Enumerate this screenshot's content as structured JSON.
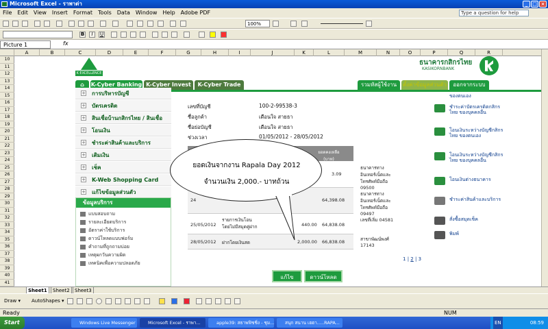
{
  "window": {
    "title": "Microsoft Excel - ราพาด่า"
  },
  "menu": {
    "items": [
      "File",
      "Edit",
      "View",
      "Insert",
      "Format",
      "Tools",
      "Data",
      "Window",
      "Help",
      "Adobe PDF"
    ],
    "help_placeholder": "Type a question for help"
  },
  "toolbar": {
    "zoom": "100%",
    "font_size": ""
  },
  "formula": {
    "namebox": "Picture 1",
    "fx": "fx"
  },
  "columns": [
    "A",
    "B",
    "C",
    "D",
    "E",
    "F",
    "G",
    "H",
    "I",
    "J",
    "K",
    "L",
    "M",
    "N",
    "O",
    "P",
    "Q",
    "R"
  ],
  "rows": [
    "10",
    "11",
    "12",
    "13",
    "14",
    "15",
    "16",
    "17",
    "18",
    "19",
    "20",
    "21",
    "22",
    "23",
    "24",
    "25",
    "26",
    "27",
    "28",
    "29",
    "30",
    "31",
    "32",
    "33",
    "34",
    "35",
    "36",
    "37",
    "38",
    "39",
    "40",
    "41"
  ],
  "bank": {
    "logo_text": "K EXCELLENCE",
    "brand_th": "ธนาคารกสิกรไทย",
    "brand_en": "KASIKORNBANK",
    "tabs": [
      "K-Cyber Banking",
      "K-Cyber Invest",
      "K-Cyber Trade"
    ],
    "right_tabs": [
      "รวมหัสผู้ใช้งาน",
      "ตั้งค่าข้อมูลส่วนตัว",
      "ออกจากระบบ"
    ],
    "left_menu": [
      "การบริหารบัญชี",
      "บัตรเครดิต",
      "สินเชื่อบ้านกสิกรไทย / สินเชื่ออื่นๆ",
      "โอนเงิน",
      "ชำระค่าสินค้าและบริการ",
      "เติมเงิน",
      "เช็ค",
      "K-Web Shopping Card",
      "แก้ไขข้อมูลส่วนตัว"
    ],
    "service_head": "ข้อมูลบริการ",
    "services": [
      "แบบสอบถาม",
      "รายละเอียดบริการ",
      "อัตราค่าใช้บริการ",
      "ดาวน์โหลดแบบฟอร์ม",
      "คำถามที่ถูกถามบ่อย",
      "เหตุผกวันความผิด",
      "เทคนิคเพื่อความปลอดภัย"
    ],
    "info_labels": [
      "เลขที่บัญชี",
      "ชื่อลูกค้า",
      "ชื่อย่อบัญชี",
      "ช่วงเวลา"
    ],
    "info_values": [
      "100-2-99538-3",
      "เดือนใจ สายธา",
      "เดือนใจ สายธา",
      "01/05/2012 - 28/05/2012"
    ],
    "table_headers": [
      "ยอดคงเหลือ (บาท)",
      "ช่องทางบริการ",
      "บันทึก"
    ],
    "rows": [
      {
        "date": "",
        "desc": "",
        "amount": "",
        "balance": "3.09",
        "channel": "ธนาคารทางอินเทอร์เน็ตและโทรศัพท์มือถือ 09500"
      },
      {
        "date": "24",
        "desc": "",
        "amount": "",
        "balance": "64,398.08",
        "channel": "ธนาคารทางอินเทอร์เน็ตและโทรศัพท์มือถือ 09497"
      },
      {
        "date": "25/05/2012",
        "desc": "รายการเงินโอนโดยไม่มีสมุดคู่ฝาก",
        "amount": "440.00",
        "balance": "64,838.08",
        "channel": "เลขที่เลิ่ม 04581"
      },
      {
        "date": "28/05/2012",
        "desc": "ฝากโดยเงินสด",
        "amount": "2,000.00",
        "balance": "66,838.08",
        "channel": "สาขาพัฒน์พงศ์ 17143"
      }
    ],
    "pagination": [
      "1",
      "2",
      "3"
    ],
    "pagination_sep": "|",
    "buttons": [
      "แก้ไข",
      "ดาวน์โหลด"
    ],
    "right_links": [
      "ของตนเอง",
      "ชำระค่าบัตรเครดิตกสิกรไทย ของบุคคลอื่น",
      "โอนเงินระหว่างบัญชีกสิกรไทย ของตนเอง",
      "โอนเงินระหว่างบัญชีกสิกรไทย ของบุคคลอื่น",
      "โอนเงินต่างธนาคาร",
      "ชำระค่าสินค้าและบริการ",
      "สั่งซื้อสมุดเช็ค",
      "พิมพ์"
    ]
  },
  "callout": {
    "line1": "ยอดเงินจากงาน Rapala Day 2012",
    "line2": "จำนวนเงิน 2,000.- บาทถ้วน"
  },
  "sheets": [
    "Sheet1",
    "Sheet2",
    "Sheet3"
  ],
  "draw": {
    "draw_label": "Draw ▾",
    "autoshapes_label": "AutoShapes ▾"
  },
  "status": {
    "left": "Ready",
    "right": "NUM"
  },
  "taskbar": {
    "start": "Start",
    "tasks": [
      "Windows Live Messenger",
      "Microsoft Excel - ราพา...",
      "apple39: สธาพฟิชชิ่ง - ชุม...",
      "สนุก สนาน เฮฮา.....RAPA..."
    ],
    "lang": "EN",
    "time": "08:59"
  }
}
